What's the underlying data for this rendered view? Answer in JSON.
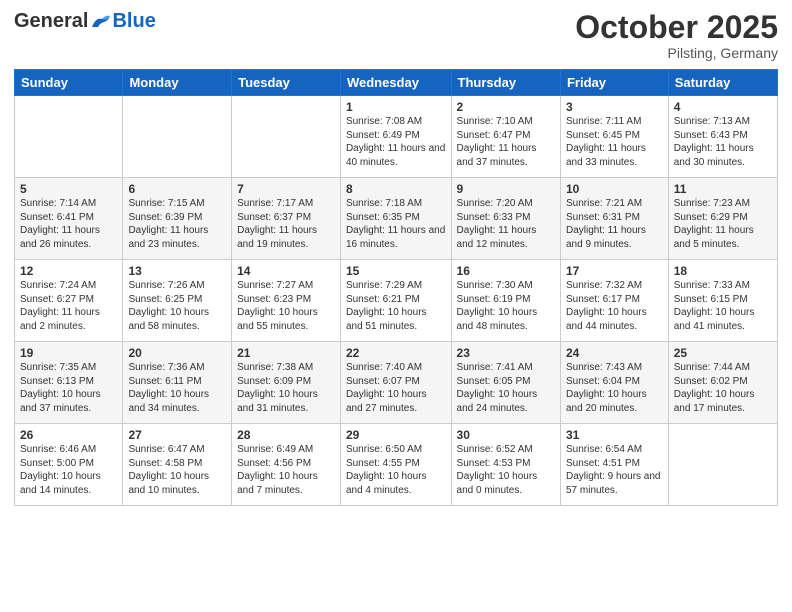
{
  "header": {
    "logo_general": "General",
    "logo_blue": "Blue",
    "month_title": "October 2025",
    "location": "Pilsting, Germany"
  },
  "days_of_week": [
    "Sunday",
    "Monday",
    "Tuesday",
    "Wednesday",
    "Thursday",
    "Friday",
    "Saturday"
  ],
  "weeks": [
    [
      {
        "day": "",
        "info": ""
      },
      {
        "day": "",
        "info": ""
      },
      {
        "day": "",
        "info": ""
      },
      {
        "day": "1",
        "info": "Sunrise: 7:08 AM\nSunset: 6:49 PM\nDaylight: 11 hours\nand 40 minutes."
      },
      {
        "day": "2",
        "info": "Sunrise: 7:10 AM\nSunset: 6:47 PM\nDaylight: 11 hours\nand 37 minutes."
      },
      {
        "day": "3",
        "info": "Sunrise: 7:11 AM\nSunset: 6:45 PM\nDaylight: 11 hours\nand 33 minutes."
      },
      {
        "day": "4",
        "info": "Sunrise: 7:13 AM\nSunset: 6:43 PM\nDaylight: 11 hours\nand 30 minutes."
      }
    ],
    [
      {
        "day": "5",
        "info": "Sunrise: 7:14 AM\nSunset: 6:41 PM\nDaylight: 11 hours\nand 26 minutes."
      },
      {
        "day": "6",
        "info": "Sunrise: 7:15 AM\nSunset: 6:39 PM\nDaylight: 11 hours\nand 23 minutes."
      },
      {
        "day": "7",
        "info": "Sunrise: 7:17 AM\nSunset: 6:37 PM\nDaylight: 11 hours\nand 19 minutes."
      },
      {
        "day": "8",
        "info": "Sunrise: 7:18 AM\nSunset: 6:35 PM\nDaylight: 11 hours\nand 16 minutes."
      },
      {
        "day": "9",
        "info": "Sunrise: 7:20 AM\nSunset: 6:33 PM\nDaylight: 11 hours\nand 12 minutes."
      },
      {
        "day": "10",
        "info": "Sunrise: 7:21 AM\nSunset: 6:31 PM\nDaylight: 11 hours\nand 9 minutes."
      },
      {
        "day": "11",
        "info": "Sunrise: 7:23 AM\nSunset: 6:29 PM\nDaylight: 11 hours\nand 5 minutes."
      }
    ],
    [
      {
        "day": "12",
        "info": "Sunrise: 7:24 AM\nSunset: 6:27 PM\nDaylight: 11 hours\nand 2 minutes."
      },
      {
        "day": "13",
        "info": "Sunrise: 7:26 AM\nSunset: 6:25 PM\nDaylight: 10 hours\nand 58 minutes."
      },
      {
        "day": "14",
        "info": "Sunrise: 7:27 AM\nSunset: 6:23 PM\nDaylight: 10 hours\nand 55 minutes."
      },
      {
        "day": "15",
        "info": "Sunrise: 7:29 AM\nSunset: 6:21 PM\nDaylight: 10 hours\nand 51 minutes."
      },
      {
        "day": "16",
        "info": "Sunrise: 7:30 AM\nSunset: 6:19 PM\nDaylight: 10 hours\nand 48 minutes."
      },
      {
        "day": "17",
        "info": "Sunrise: 7:32 AM\nSunset: 6:17 PM\nDaylight: 10 hours\nand 44 minutes."
      },
      {
        "day": "18",
        "info": "Sunrise: 7:33 AM\nSunset: 6:15 PM\nDaylight: 10 hours\nand 41 minutes."
      }
    ],
    [
      {
        "day": "19",
        "info": "Sunrise: 7:35 AM\nSunset: 6:13 PM\nDaylight: 10 hours\nand 37 minutes."
      },
      {
        "day": "20",
        "info": "Sunrise: 7:36 AM\nSunset: 6:11 PM\nDaylight: 10 hours\nand 34 minutes."
      },
      {
        "day": "21",
        "info": "Sunrise: 7:38 AM\nSunset: 6:09 PM\nDaylight: 10 hours\nand 31 minutes."
      },
      {
        "day": "22",
        "info": "Sunrise: 7:40 AM\nSunset: 6:07 PM\nDaylight: 10 hours\nand 27 minutes."
      },
      {
        "day": "23",
        "info": "Sunrise: 7:41 AM\nSunset: 6:05 PM\nDaylight: 10 hours\nand 24 minutes."
      },
      {
        "day": "24",
        "info": "Sunrise: 7:43 AM\nSunset: 6:04 PM\nDaylight: 10 hours\nand 20 minutes."
      },
      {
        "day": "25",
        "info": "Sunrise: 7:44 AM\nSunset: 6:02 PM\nDaylight: 10 hours\nand 17 minutes."
      }
    ],
    [
      {
        "day": "26",
        "info": "Sunrise: 6:46 AM\nSunset: 5:00 PM\nDaylight: 10 hours\nand 14 minutes."
      },
      {
        "day": "27",
        "info": "Sunrise: 6:47 AM\nSunset: 4:58 PM\nDaylight: 10 hours\nand 10 minutes."
      },
      {
        "day": "28",
        "info": "Sunrise: 6:49 AM\nSunset: 4:56 PM\nDaylight: 10 hours\nand 7 minutes."
      },
      {
        "day": "29",
        "info": "Sunrise: 6:50 AM\nSunset: 4:55 PM\nDaylight: 10 hours\nand 4 minutes."
      },
      {
        "day": "30",
        "info": "Sunrise: 6:52 AM\nSunset: 4:53 PM\nDaylight: 10 hours\nand 0 minutes."
      },
      {
        "day": "31",
        "info": "Sunrise: 6:54 AM\nSunset: 4:51 PM\nDaylight: 9 hours\nand 57 minutes."
      },
      {
        "day": "",
        "info": ""
      }
    ]
  ]
}
